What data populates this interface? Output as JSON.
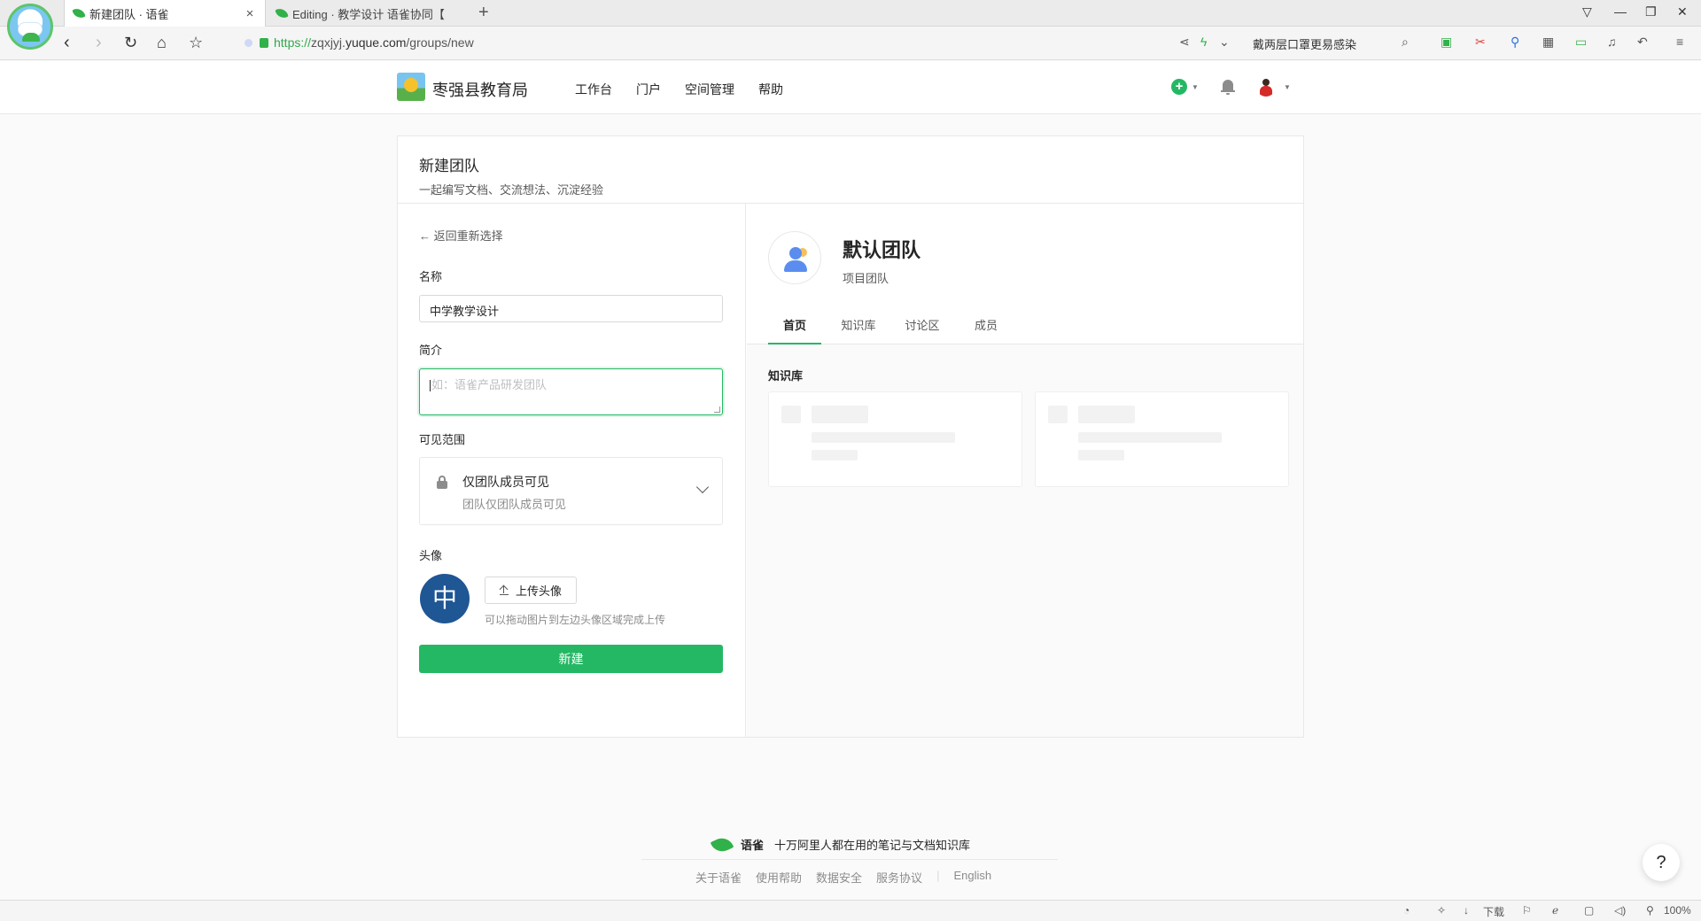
{
  "browser": {
    "tabs": [
      {
        "title": "新建团队 · 语雀",
        "active": true
      },
      {
        "title": "Editing · 教学设计 语雀协同【",
        "active": false
      }
    ],
    "new_tab": "+",
    "url_scheme": "https://",
    "url_sub": "zqxjyj.",
    "url_host": "yuque.com",
    "url_path": "/groups/new",
    "search_hint": "戴两层口罩更易感染",
    "status": {
      "download": "下载",
      "zoom": "100%"
    }
  },
  "header": {
    "site_name": "枣强县教育局",
    "nav": [
      "工作台",
      "门户",
      "空间管理",
      "帮助"
    ],
    "add_icon": "plus-circle-icon",
    "bell_icon": "bell-icon"
  },
  "page": {
    "title": "新建团队",
    "subtitle": "一起编写文档、交流想法、沉淀经验",
    "back_link": "返回重新选择",
    "name_label": "名称",
    "name_value": "中学教学设计",
    "intro_label": "简介",
    "intro_placeholder": "如：语雀产品研发团队",
    "visibility_label": "可见范围",
    "visibility_title": "仅团队成员可见",
    "visibility_desc": "团队仅团队成员可见",
    "avatar_label": "头像",
    "avatar_char": "中",
    "avatar_color": "#1f5694",
    "upload_label": "上传头像",
    "upload_hint": "可以拖动图片到左边头像区域完成上传",
    "submit_label": "新建",
    "accent_color": "#25b864"
  },
  "preview": {
    "team_name": "默认团队",
    "team_type": "项目团队",
    "tabs": [
      "首页",
      "知识库",
      "讨论区",
      "成员"
    ],
    "active_tab": "首页",
    "section_label": "知识库"
  },
  "footer": {
    "brand": "语雀",
    "slogan": "十万阿里人都在用的笔记与文档知识库",
    "links": [
      "关于语雀",
      "使用帮助",
      "数据安全",
      "服务协议",
      "English"
    ]
  },
  "help_button": "?"
}
